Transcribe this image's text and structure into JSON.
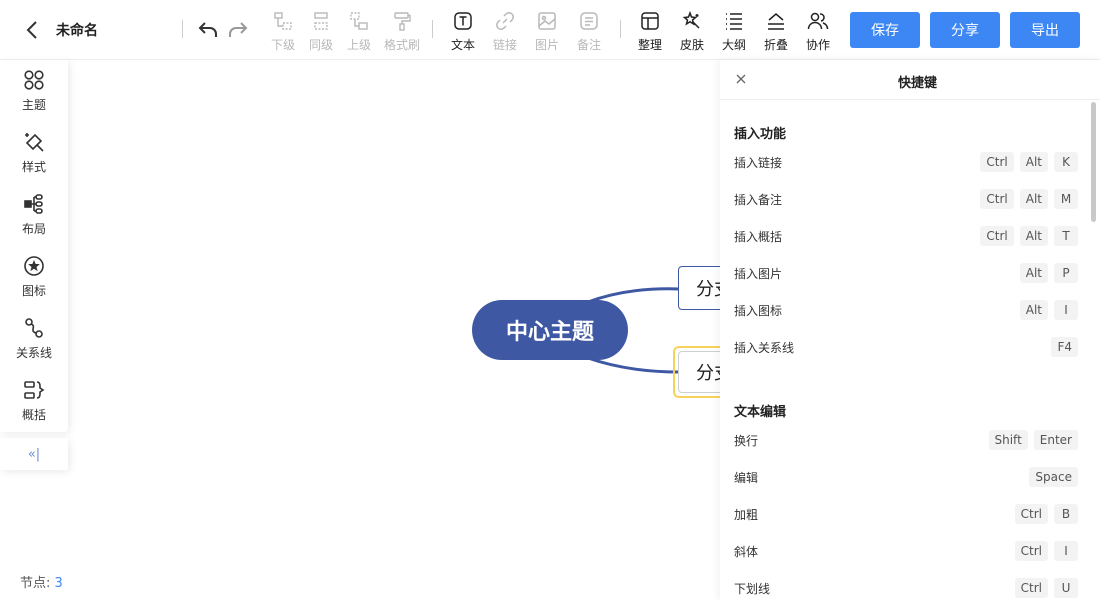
{
  "header": {
    "title": "未命名"
  },
  "toolbar": {
    "tools": [
      {
        "label": "下级",
        "icon": "child-node-icon",
        "enabled": false
      },
      {
        "label": "同级",
        "icon": "sibling-node-icon",
        "enabled": false
      },
      {
        "label": "上级",
        "icon": "parent-node-icon",
        "enabled": false
      },
      {
        "label": "格式刷",
        "icon": "format-brush-icon",
        "enabled": false
      },
      {
        "label": "文本",
        "icon": "text-icon",
        "enabled": true
      },
      {
        "label": "链接",
        "icon": "link-icon",
        "enabled": false
      },
      {
        "label": "图片",
        "icon": "image-icon",
        "enabled": false
      },
      {
        "label": "备注",
        "icon": "note-icon",
        "enabled": false
      },
      {
        "label": "整理",
        "icon": "organize-icon",
        "enabled": true
      },
      {
        "label": "皮肤",
        "icon": "skin-icon",
        "enabled": true
      },
      {
        "label": "大纲",
        "icon": "outline-icon",
        "enabled": true
      },
      {
        "label": "折叠",
        "icon": "fold-icon",
        "enabled": true
      },
      {
        "label": "协作",
        "icon": "collaborate-icon",
        "enabled": true
      }
    ],
    "save_label": "保存",
    "share_label": "分享",
    "export_label": "导出"
  },
  "sidebar": {
    "items": [
      {
        "label": "主题",
        "icon": "theme-icon"
      },
      {
        "label": "样式",
        "icon": "style-icon"
      },
      {
        "label": "布局",
        "icon": "layout-icon"
      },
      {
        "label": "图标",
        "icon": "star-circle-icon"
      },
      {
        "label": "关系线",
        "icon": "relation-line-icon"
      },
      {
        "label": "概括",
        "icon": "summary-icon"
      }
    ],
    "collapse_label": "«|"
  },
  "canvas": {
    "central_topic": "中心主题",
    "branches": [
      "分支主题",
      "分支主题"
    ],
    "node_count_label": "节点: ",
    "node_count": "3"
  },
  "shortcuts": {
    "title": "快捷键",
    "sections": [
      {
        "title": "插入功能",
        "items": [
          {
            "name": "插入链接",
            "keys": [
              "Ctrl",
              "Alt",
              "K"
            ]
          },
          {
            "name": "插入备注",
            "keys": [
              "Ctrl",
              "Alt",
              "M"
            ]
          },
          {
            "name": "插入概括",
            "keys": [
              "Ctrl",
              "Alt",
              "T"
            ]
          },
          {
            "name": "插入图片",
            "keys": [
              "Alt",
              "P"
            ]
          },
          {
            "name": "插入图标",
            "keys": [
              "Alt",
              "I"
            ]
          },
          {
            "name": "插入关系线",
            "keys": [
              "F4"
            ]
          }
        ]
      },
      {
        "title": "文本编辑",
        "items": [
          {
            "name": "换行",
            "keys": [
              "Shift",
              "Enter"
            ]
          },
          {
            "name": "编辑",
            "keys": [
              "Space"
            ]
          },
          {
            "name": "加粗",
            "keys": [
              "Ctrl",
              "B"
            ]
          },
          {
            "name": "斜体",
            "keys": [
              "Ctrl",
              "I"
            ]
          },
          {
            "name": "下划线",
            "keys": [
              "Ctrl",
              "U"
            ]
          }
        ]
      }
    ]
  },
  "colors": {
    "primary_button": "#3d87f5",
    "central_topic": "#3f58a3",
    "selected_outline": "#f5d35a"
  }
}
